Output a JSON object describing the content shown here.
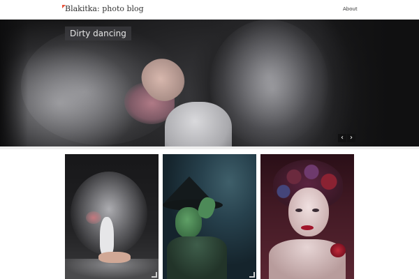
{
  "header": {
    "site_title": "Blakitka: photo blog",
    "nav": [
      {
        "label": "About"
      }
    ]
  },
  "slider": {
    "caption": "Dirty dancing",
    "prev_icon": "chevron-left-icon",
    "next_icon": "chevron-right-icon",
    "prev_glyph": "‹",
    "next_glyph": "›"
  },
  "gallery": {
    "items": [
      {
        "subject": "dancer-in-dust"
      },
      {
        "subject": "green-witch"
      },
      {
        "subject": "flower-crown-portrait"
      }
    ]
  },
  "colors": {
    "accent": "#e8523a",
    "header_bg": "#ffffff",
    "text": "#333333"
  }
}
